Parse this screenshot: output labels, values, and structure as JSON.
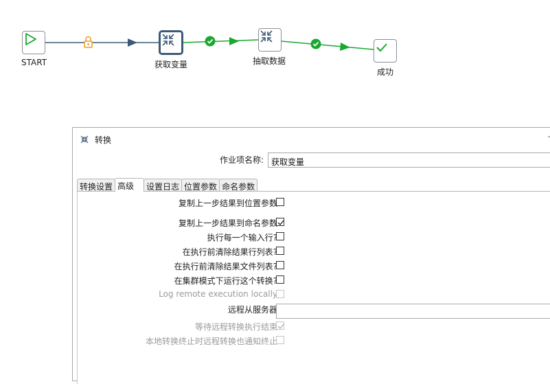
{
  "workflow": {
    "nodes": [
      {
        "id": "start",
        "label": "START",
        "icon": "play-icon"
      },
      {
        "id": "get-vars",
        "label": "获取变量",
        "icon": "transform-icon"
      },
      {
        "id": "extract",
        "label": "抽取数据",
        "icon": "transform-icon"
      },
      {
        "id": "success",
        "label": "成功",
        "icon": "check-icon"
      }
    ],
    "hops": [
      {
        "from": "START",
        "to": "获取变量",
        "marker": "lock-icon"
      },
      {
        "from": "获取变量",
        "to": "抽取数据",
        "marker": "success-check-icon"
      },
      {
        "from": "抽取数据",
        "to": "成功",
        "marker": "success-check-icon"
      }
    ],
    "colors": {
      "hop_unconditional": "#3c5a78",
      "hop_success": "#1aa82f",
      "lock": "#f29a1b"
    }
  },
  "dialog": {
    "title": "转换",
    "close_label": "−",
    "job_entry_name_label": "作业项名称:",
    "job_entry_name_value": "获取变量",
    "tabs": [
      "转换设置",
      "高级",
      "设置日志",
      "位置参数",
      "命名参数"
    ],
    "active_tab": "高级",
    "options": [
      {
        "label": "复制上一步结果到位置参数",
        "checked": false,
        "enabled": true
      },
      {
        "label": "复制上一步结果到命名参数",
        "checked": true,
        "enabled": true
      },
      {
        "label": "执行每一个输入行?",
        "checked": false,
        "enabled": true
      },
      {
        "label": "在执行前清除结果行列表?",
        "checked": false,
        "enabled": true
      },
      {
        "label": "在执行前清除结果文件列表?",
        "checked": false,
        "enabled": true
      },
      {
        "label": "在集群模式下运行这个转换?",
        "checked": false,
        "enabled": true
      },
      {
        "label": "Log remote execution locally",
        "checked": false,
        "enabled": false
      }
    ],
    "remote_slave_label": "远程从服务器",
    "remote_slave_value": "",
    "wait_remote_label": "等待远程转换执行结束",
    "wait_remote_checked": true,
    "notify_remote_label": "本地转换终止时远程转换也通知终止",
    "notify_remote_checked": false
  }
}
